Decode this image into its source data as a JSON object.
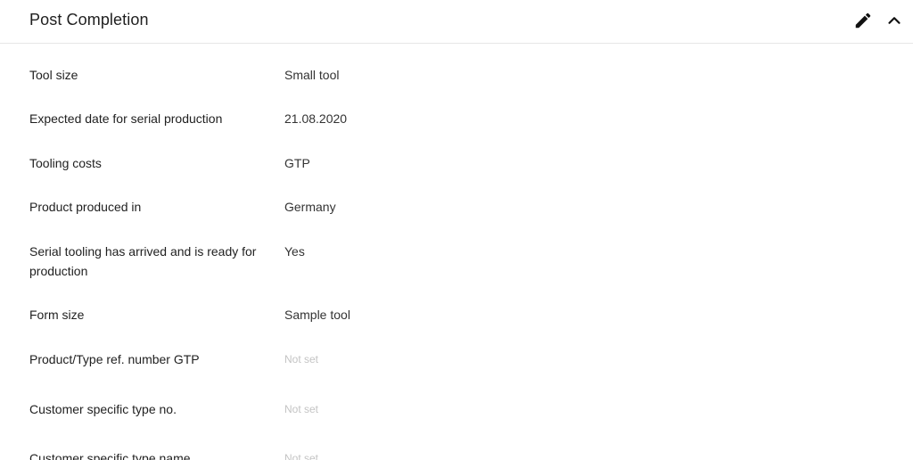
{
  "panel": {
    "title": "Post Completion",
    "edit_icon": "pencil-icon",
    "collapse_icon": "chevron-up-icon"
  },
  "fields": [
    {
      "label": "Tool size",
      "value": "Small tool"
    },
    {
      "label": "Expected date for serial production",
      "value": "21.08.2020"
    },
    {
      "label": "Tooling costs",
      "value": "GTP"
    },
    {
      "label": "Product produced in",
      "value": "Germany"
    },
    {
      "label": "Serial tooling has arrived and is ready for production",
      "value": "Yes"
    },
    {
      "label": "Form size",
      "value": "Sample tool"
    },
    {
      "label": "Product/Type ref. number GTP",
      "value": "Not set"
    },
    {
      "label": "Customer specific type no.",
      "value": "Not set"
    },
    {
      "label": "Customer specific type name",
      "value": "Not set"
    }
  ]
}
